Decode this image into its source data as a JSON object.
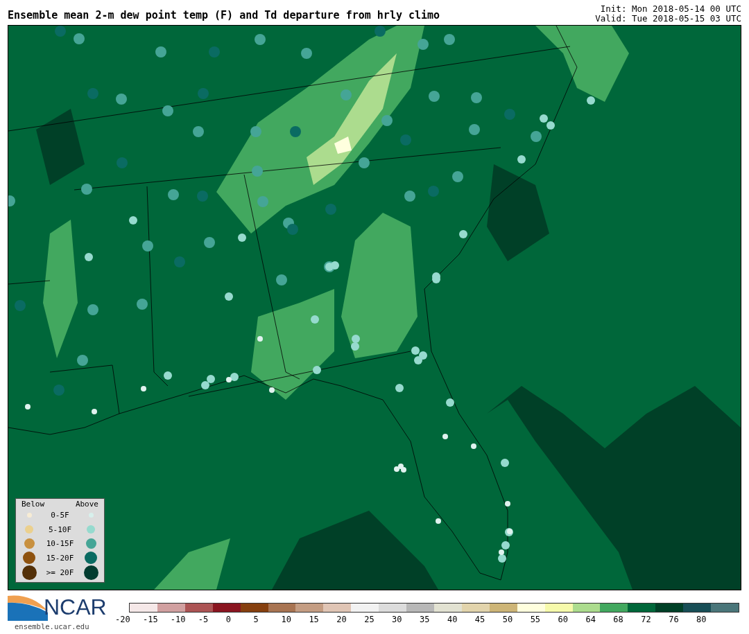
{
  "title": "Ensemble mean 2-m dew point temp (F) and Td departure from hrly climo",
  "init": "Init: Mon 2018-05-14 00 UTC",
  "valid": "Valid: Tue 2018-05-15 03 UTC",
  "legend": {
    "below_label": "Below",
    "above_label": "Above",
    "rows": [
      {
        "label": "0-5F",
        "below": {
          "color": "#f7ecd4"
        },
        "above": {
          "color": "#d7f0ec"
        }
      },
      {
        "label": "5-10F",
        "below": {
          "color": "#ebd08e"
        },
        "above": {
          "color": "#96dace"
        }
      },
      {
        "label": "10-15F",
        "below": {
          "color": "#c8903f"
        },
        "above": {
          "color": "#45a596"
        }
      },
      {
        "label": "15-20F",
        "below": {
          "color": "#8e520f"
        },
        "above": {
          "color": "#0a6b62"
        }
      },
      {
        "label": ">= 20F",
        "below": {
          "color": "#533008"
        },
        "above": {
          "color": "#023c30"
        }
      }
    ]
  },
  "logo": {
    "text": "NCAR",
    "url": "ensemble.ucar.edu"
  },
  "colorbar": {
    "swatches": [
      {
        "color": "#f5e8e8"
      },
      {
        "color": "#d1a0a0"
      },
      {
        "color": "#ac5454"
      },
      {
        "color": "#8a1520"
      },
      {
        "color": "#86400f"
      },
      {
        "color": "#a87452"
      },
      {
        "color": "#c49d83"
      },
      {
        "color": "#e0c5b5"
      },
      {
        "color": "#f2f2f2"
      },
      {
        "color": "#dcdcdc"
      },
      {
        "color": "#b8b8b8"
      },
      {
        "color": "#e2e2d2"
      },
      {
        "color": "#e2d4ac"
      },
      {
        "color": "#cdb577"
      },
      {
        "color": "#ffffde"
      },
      {
        "color": "#f6faab"
      },
      {
        "color": "#acdc8e"
      },
      {
        "color": "#42a85f"
      },
      {
        "color": "#00673a"
      },
      {
        "color": "#004027"
      },
      {
        "color": "#184e56"
      },
      {
        "color": "#4a767a"
      }
    ],
    "ticks": [
      "-20",
      "-15",
      "-10",
      "-5",
      "0",
      "5",
      "10",
      "15",
      "20",
      "25",
      "30",
      "35",
      "40",
      "45",
      "50",
      "55",
      "60",
      "64",
      "68",
      "72",
      "76",
      "80"
    ]
  }
}
